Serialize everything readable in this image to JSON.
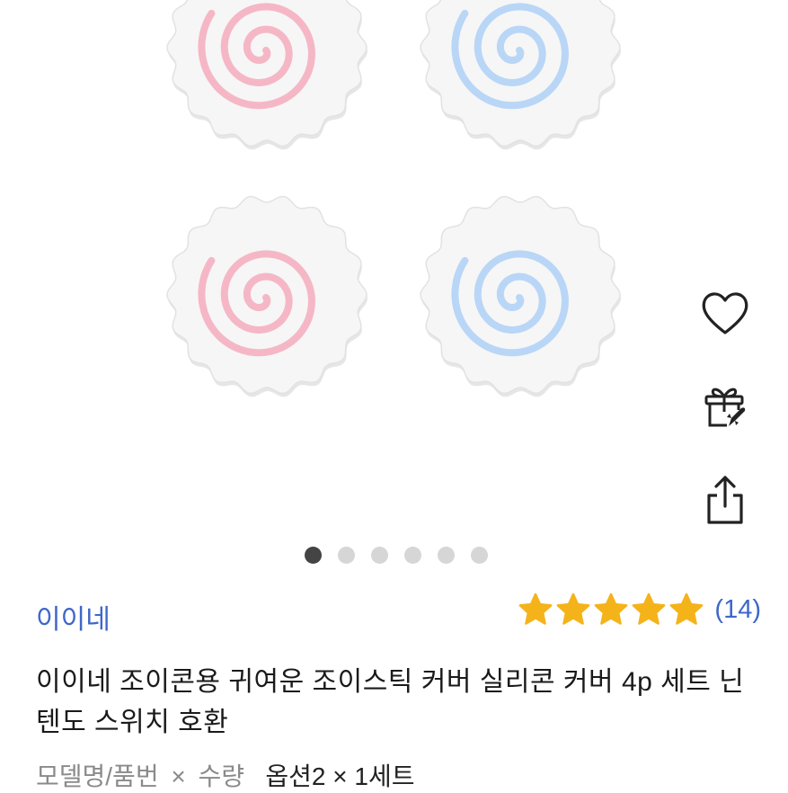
{
  "product_images": {
    "caps": [
      {
        "name": "pink-swirl-cap",
        "color": "#f5b7c6"
      },
      {
        "name": "blue-swirl-cap",
        "color": "#b9d6f7"
      },
      {
        "name": "pink-swirl-cap",
        "color": "#f5b7c6"
      },
      {
        "name": "blue-swirl-cap",
        "color": "#b9d6f7"
      }
    ],
    "indicator": {
      "total": 6,
      "active": 0
    }
  },
  "actions": [
    {
      "name": "wishlist-heart-icon",
      "icon": "heart"
    },
    {
      "name": "gift-icon",
      "icon": "gift"
    },
    {
      "name": "share-icon",
      "icon": "share"
    }
  ],
  "product": {
    "brand": "이이네",
    "rating": {
      "stars": 5,
      "count_text": "(14)",
      "star_color": "#f5b31a"
    },
    "title": "이이네 조이콘용 귀여운 조이스틱 커버 실리콘 커버 4p 세트 닌텐도 스위치 호환",
    "options": {
      "label1": "모델명/품번",
      "x": "×",
      "label2": "수량",
      "value": "옵션2",
      "value_x": "×",
      "qty": "1세트"
    }
  },
  "colors": {
    "link": "#3f67c9",
    "dot_active": "#444444",
    "dot_inactive": "#d6d6d6"
  }
}
